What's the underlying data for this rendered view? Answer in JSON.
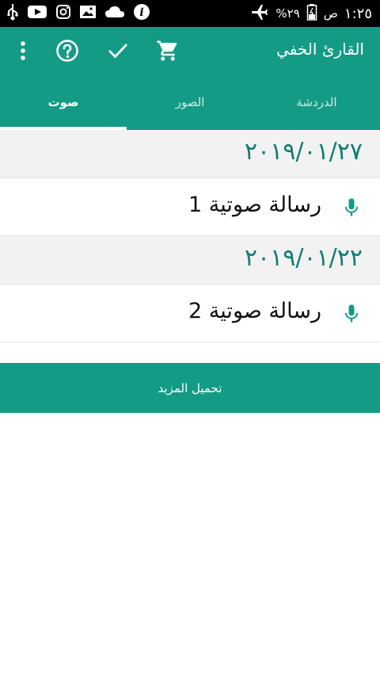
{
  "status_bar": {
    "time": "١:٢٥",
    "ampm": "ص",
    "battery": "٢٩%"
  },
  "app_bar": {
    "title": "القارئ الخفي"
  },
  "tabs": [
    {
      "label": "الدردشة"
    },
    {
      "label": "الصور"
    },
    {
      "label": "صوت"
    }
  ],
  "groups": [
    {
      "date": "٢٠١٩/٠١/٢٧",
      "items": [
        {
          "label": "رسالة صوتية 1"
        }
      ]
    },
    {
      "date": "٢٠١٩/٠١/٢٢",
      "items": [
        {
          "label": "رسالة صوتية 2"
        }
      ]
    }
  ],
  "load_more": {
    "label": "تحميل المزيد"
  },
  "colors": {
    "primary": "#139b86",
    "date_text": "#0f7d71",
    "status_bar": "#000000"
  }
}
